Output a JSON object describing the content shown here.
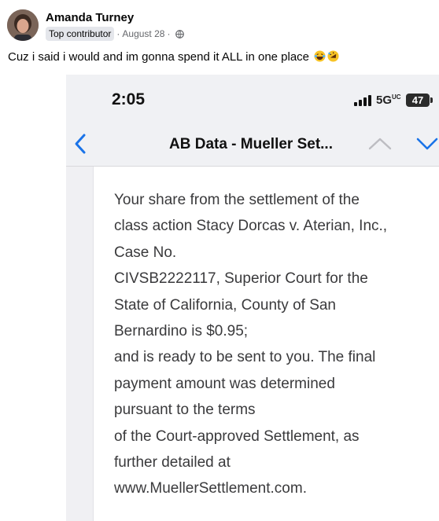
{
  "post": {
    "author": "Amanda Turney",
    "badge": "Top contributor",
    "separator": "·",
    "date": "August 28",
    "date_separator": "·",
    "audience_icon": "globe-icon",
    "caption": "Cuz i said i would and im gonna spend it ALL in one place",
    "caption_emojis": [
      "laughing-tears-emoji",
      "rolling-laughing-emoji"
    ]
  },
  "screenshot": {
    "status_bar": {
      "time": "2:05",
      "network": "5G",
      "network_suffix": "UC",
      "battery": "47"
    },
    "nav": {
      "title": "AB Data - Mueller Set...",
      "back_icon": "chevron-left-icon",
      "prev_icon": "chevron-up-icon",
      "next_icon": "chevron-down-icon"
    },
    "message_lines": [
      "Your share from the settlement of the",
      "class action Stacy Dorcas v. Aterian, Inc.,",
      "Case No.",
      "CIVSB2222117, Superior Court for the",
      "State of California, County of San",
      "Bernardino is $0.95;",
      "and is ready to be sent to you. The final",
      "payment amount was determined",
      "pursuant to the terms",
      "of the Court-approved Settlement, as",
      "further detailed at",
      "www.MuellerSettlement.com."
    ]
  },
  "colors": {
    "ios_blue": "#1a73e8",
    "badge_bg": "#e4e6eb",
    "meta_gray": "#65676b"
  }
}
